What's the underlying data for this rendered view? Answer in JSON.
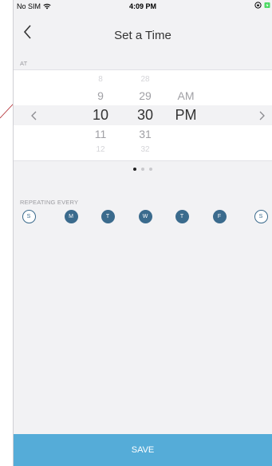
{
  "status_bar": {
    "carrier": "No SIM",
    "time": "4:09 PM"
  },
  "nav": {
    "title": "Set a Time",
    "back_icon": "chevron-left-icon"
  },
  "at_section": {
    "label": "AT"
  },
  "time_picker": {
    "hours": [
      "8",
      "9",
      "10",
      "11",
      "12"
    ],
    "minutes": [
      "28",
      "29",
      "30",
      "31",
      "32"
    ],
    "periods": [
      "AM",
      "PM"
    ],
    "selected_hour": "10",
    "selected_minute": "30",
    "selected_period": "PM",
    "prev_icon": "chevron-left-icon",
    "next_icon": "chevron-right-icon"
  },
  "pager": {
    "count": 3,
    "active_index": 0
  },
  "repeating": {
    "label": "REPEATING EVERY",
    "days": [
      {
        "letter": "S",
        "selected": false
      },
      {
        "letter": "M",
        "selected": true
      },
      {
        "letter": "T",
        "selected": true
      },
      {
        "letter": "W",
        "selected": true
      },
      {
        "letter": "T",
        "selected": true
      },
      {
        "letter": "F",
        "selected": true
      },
      {
        "letter": "S",
        "selected": false
      }
    ]
  },
  "save": {
    "label": "SAVE"
  },
  "colors": {
    "accent": "#3b6b8d",
    "save_bar": "#55acd8",
    "background": "#f2f2f4",
    "annotation_line": "#b0282e"
  }
}
